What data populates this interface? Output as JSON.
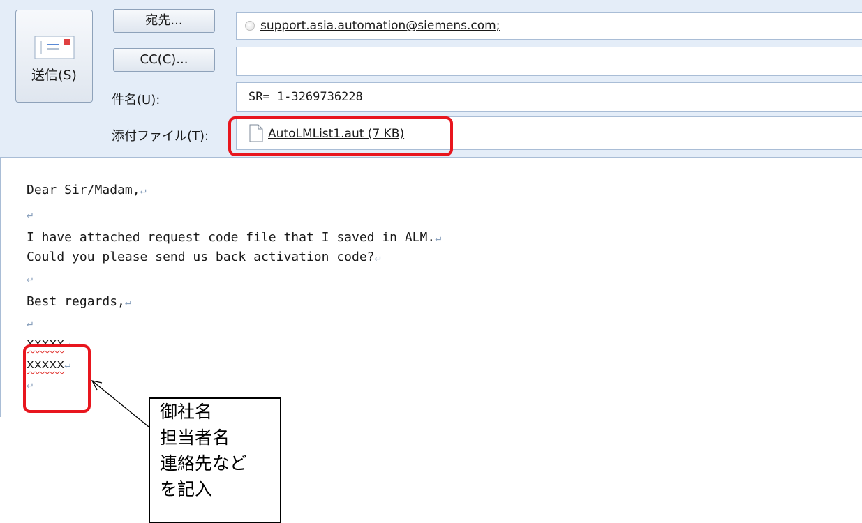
{
  "header": {
    "send_label": "送信(S)",
    "to_button": "宛先...",
    "cc_button": "CC(C)...",
    "subject_label": "件名(U):",
    "attachment_label": "添付ファイル(T):",
    "to_value": "support.asia.automation@siemens.com;",
    "cc_value": "",
    "subject_value": "SR= 1-3269736228",
    "attachment_value": "AutoLMList1.aut (7 KB)"
  },
  "body": {
    "lines": [
      "Dear Sir/Madam,",
      "",
      "I have attached request code file that I saved in ALM.",
      "Could you please send us back activation code?",
      "",
      "Best regards,",
      "",
      "xxxxx",
      "xxxxx",
      ""
    ],
    "paragraph_mark": "↵"
  },
  "annotation": {
    "lines": [
      "御社名",
      "担当者名",
      "連絡先など",
      "を記入"
    ]
  },
  "colors": {
    "highlight": "#e8161e",
    "header_bg": "#e4edf8",
    "spell_underline": "#e0302c"
  },
  "icons": {
    "send": "envelope-icon",
    "contact": "contact-dot-icon",
    "attachment": "file-icon"
  }
}
